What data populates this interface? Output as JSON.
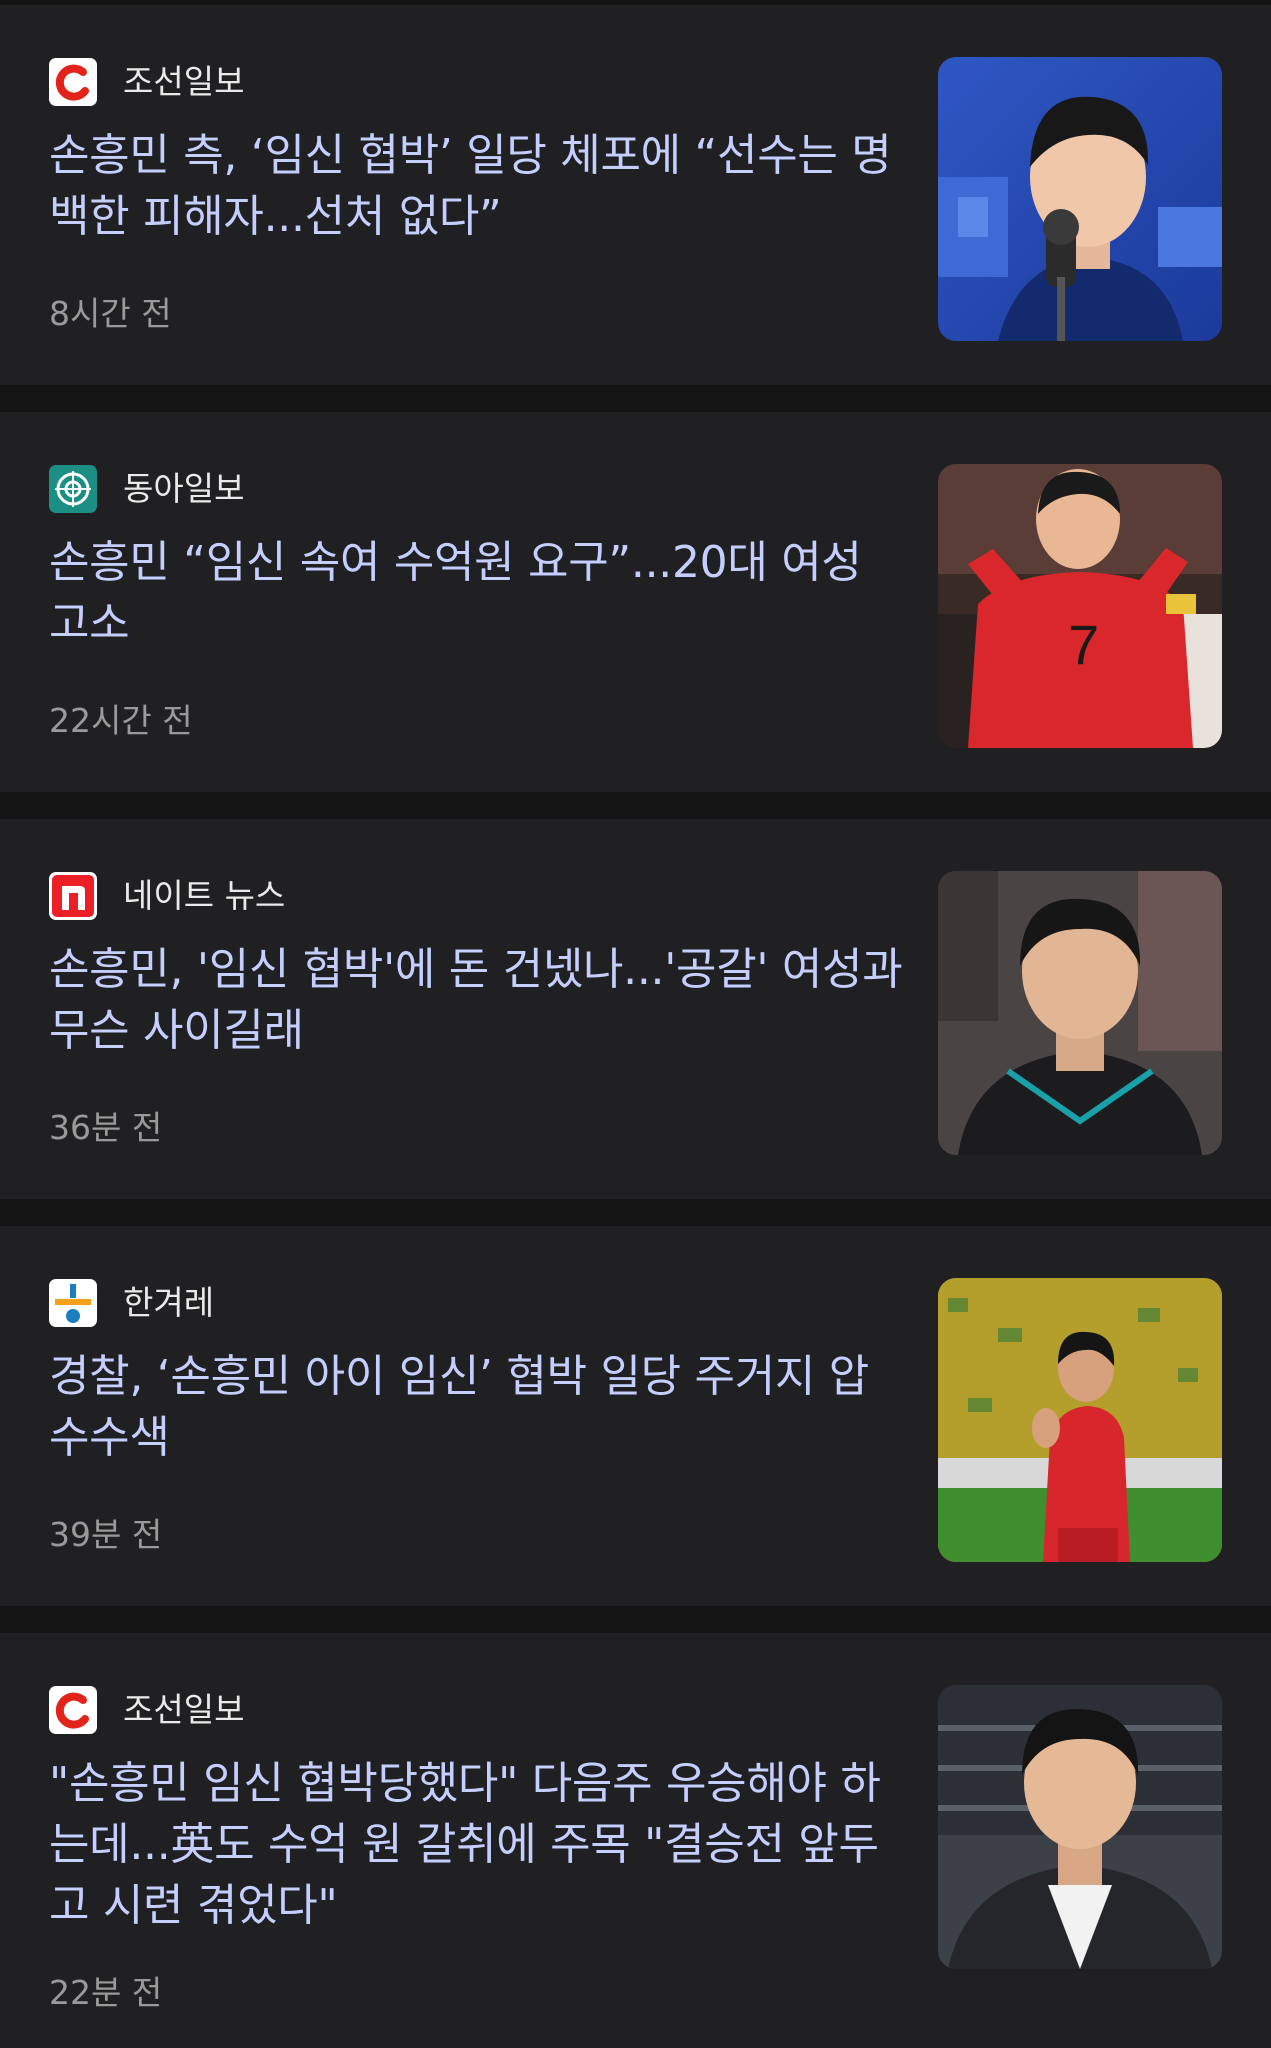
{
  "articles": [
    {
      "source": "조선일보",
      "source_logo_icon": "chosun-logo-icon",
      "headline": "손흥민 측, ‘임신 협박’ 일당 체포에 “선수는 명백한 피해자...선처 없다”",
      "time": "8시간 전",
      "thumbnail_icon": "press-conference-photo"
    },
    {
      "source": "동아일보",
      "source_logo_icon": "donga-logo-icon",
      "headline": "손흥민 “임신 속여 수억원 요구”...20대 여성 고소",
      "time": "22시간 전",
      "thumbnail_icon": "red-jersey-photo"
    },
    {
      "source": "네이트 뉴스",
      "source_logo_icon": "nate-logo-icon",
      "headline": "손흥민, '임신 협박'에 돈 건넸나...'공갈' 여성과 무슨 사이길래",
      "time": "36분 전",
      "thumbnail_icon": "portrait-photo"
    },
    {
      "source": "한겨레",
      "source_logo_icon": "hani-logo-icon",
      "headline": "경찰, ‘손흥민 아이 임신’ 협박 일당 주거지 압수수색",
      "time": "39분 전",
      "thumbnail_icon": "stadium-applause-photo"
    },
    {
      "source": "조선일보",
      "source_logo_icon": "chosun-logo-icon",
      "headline": "\"손흥민 임신 협박당했다\" 다음주 우승해야 하는데...英도 수억 원 갈취에 주목 \"결승전 앞두고 시련 겪었다\"",
      "time": "22분 전",
      "thumbnail_icon": "stadium-portrait-photo"
    }
  ],
  "colors": {
    "background": "#141414",
    "card": "#202022",
    "headline": "#c4ceff",
    "source": "#eaeaea",
    "time": "#9a9a9a"
  }
}
